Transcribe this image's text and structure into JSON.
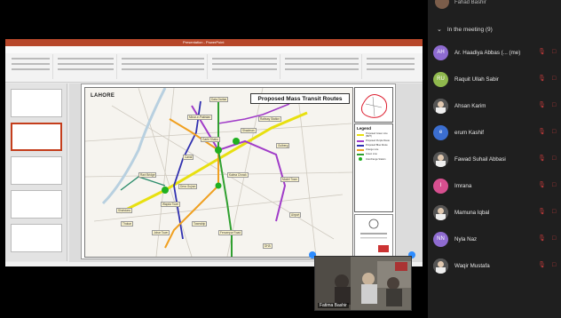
{
  "slide": {
    "city": "LAHORE",
    "title": "Proposed Mass Transit Routes",
    "legend_title": "Legend",
    "legend_items": [
      {
        "label": "Proposed Green Line (BRT)",
        "color": "#e8e010"
      },
      {
        "label": "Proposed Purple Route",
        "color": "#a03cc8"
      },
      {
        "label": "Proposed Blue Route",
        "color": "#3030b0"
      },
      {
        "label": "Orange Line",
        "color": "#f0a020"
      },
      {
        "label": "Green Line",
        "color": "#30a030"
      },
      {
        "label": "Interchange Station",
        "color": "#20b020"
      }
    ],
    "station_labels": [
      "Shahdara",
      "Ravi Bridge",
      "Minar-e-Pakistan",
      "Data Darbar",
      "Railway Station",
      "Gulberg",
      "Model Town",
      "Johar Town",
      "Thokar",
      "Dera Gujran",
      "Airport",
      "DHA",
      "Ferozepur Road",
      "Township",
      "Kalma Chowk",
      "Canal",
      "Shadman",
      "Garhi Shahu",
      "Wapda Town"
    ]
  },
  "panel": {
    "self_top_name": "Fahad Bashir",
    "section_label": "In the meeting (9)",
    "participants": [
      {
        "name": "Ar. Haadiya Abbas (... (me)",
        "initials": "AH",
        "avatar_color": "#8e6bd0",
        "photo": false
      },
      {
        "name": "Raquit Ullah Sabir",
        "initials": "RU",
        "avatar_color": "#8fb84d",
        "photo": false
      },
      {
        "name": "Ahsan Karim",
        "initials": "",
        "avatar_color": "#6b6b6b",
        "photo": true
      },
      {
        "name": "erum Kashif",
        "initials": "e",
        "avatar_color": "#3b6ed0",
        "photo": false
      },
      {
        "name": "Fawad Suhail Abbasi",
        "initials": "",
        "avatar_color": "#6b6b6b",
        "photo": true
      },
      {
        "name": "Imrana",
        "initials": "I",
        "avatar_color": "#d64f8f",
        "photo": false
      },
      {
        "name": "Mamuna Iqbal",
        "initials": "",
        "avatar_color": "#a07060",
        "photo": true
      },
      {
        "name": "Nyla Naz",
        "initials": "NN",
        "avatar_color": "#8e6bd0",
        "photo": false
      },
      {
        "name": "Waqir Mustafa",
        "initials": "",
        "avatar_color": "#777",
        "photo": true
      }
    ]
  },
  "video": {
    "name": "Fatima Bashir"
  },
  "ppt": {
    "window_title": "Presentation - PowerPoint",
    "tabs": [
      "File",
      "Home",
      "Insert",
      "Design",
      "Transitions",
      "Animations",
      "Slide Show",
      "Review",
      "View",
      "Help"
    ]
  }
}
